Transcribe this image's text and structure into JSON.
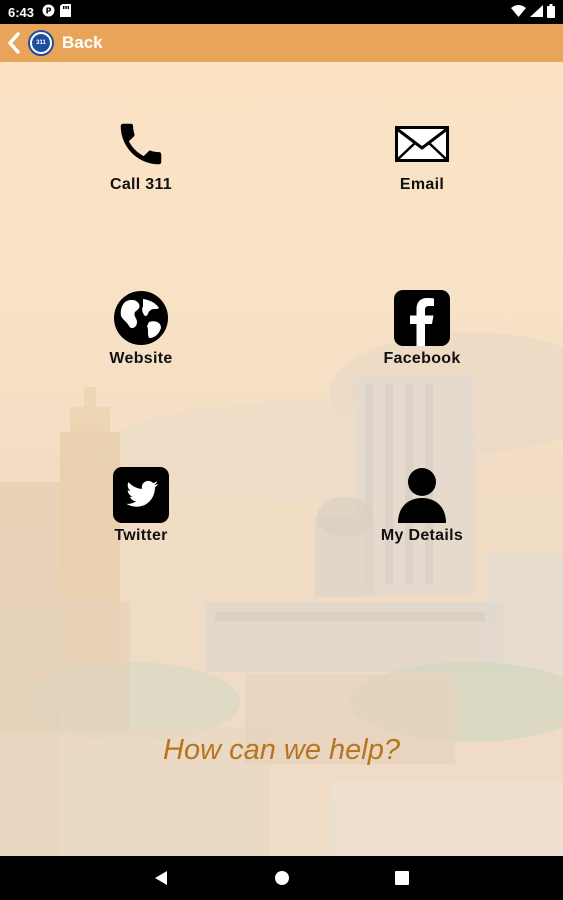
{
  "status_bar": {
    "time": "6:43",
    "left_icons": [
      "notification-app-icon",
      "sd-card-icon"
    ],
    "right_icons": [
      "wifi-icon",
      "signal-icon",
      "battery-icon"
    ]
  },
  "app_bar": {
    "back_label": "Back",
    "logo_text": "311",
    "background": "#e8a55a"
  },
  "tiles": [
    {
      "id": "call",
      "label": "Call 311",
      "icon": "phone-icon"
    },
    {
      "id": "email",
      "label": "Email",
      "icon": "envelope-icon"
    },
    {
      "id": "website",
      "label": "Website",
      "icon": "globe-icon"
    },
    {
      "id": "facebook",
      "label": "Facebook",
      "icon": "facebook-icon"
    },
    {
      "id": "twitter",
      "label": "Twitter",
      "icon": "twitter-icon"
    },
    {
      "id": "mydetails",
      "label": "My Details",
      "icon": "user-icon"
    }
  ],
  "prompt": "How can we help?",
  "colors": {
    "accent": "#e8a55a",
    "prompt_text": "#b8741e",
    "logo_blue": "#1f4e9c"
  },
  "nav_bar": {
    "buttons": [
      "back-triangle-icon",
      "home-circle-icon",
      "recents-square-icon"
    ]
  }
}
